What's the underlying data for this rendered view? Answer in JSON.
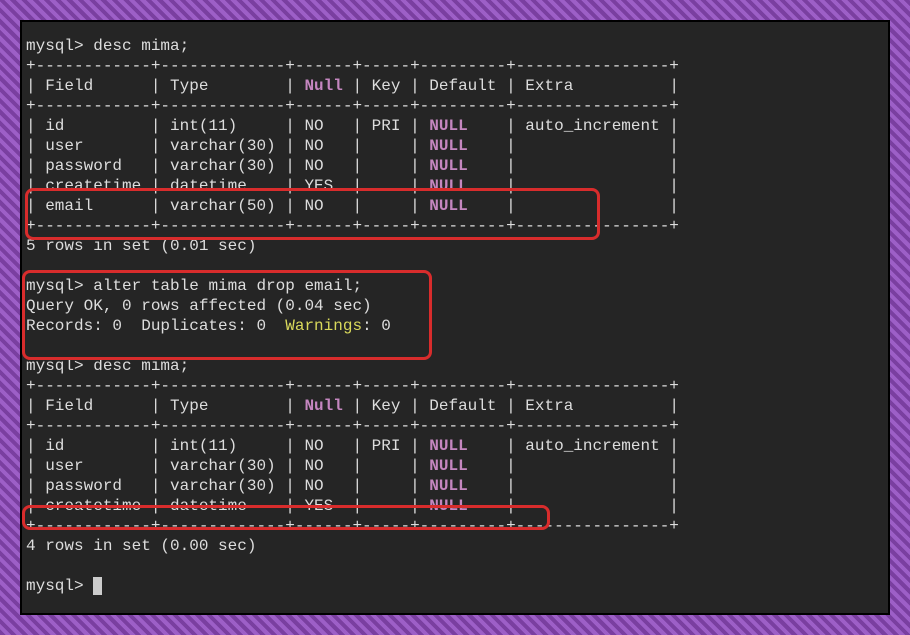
{
  "prompt": "mysql>",
  "cmd1": "desc mima;",
  "table1": {
    "sep_top": "+------------+-------------+------+-----+---------+----------------+",
    "header": "| Field      | Type        | ",
    "header_null": "Null",
    "header2": " | Key | Default | Extra          |",
    "sep_mid": "+------------+-------------+------+-----+---------+----------------+",
    "r1a": "| id         | int(11)     | NO   | PRI | ",
    "r1n": "NULL",
    "r1b": "    | auto_increment |",
    "r2a": "| user       | varchar(30) | NO   |     | ",
    "r2n": "NULL",
    "r2b": "    |                |",
    "r3a": "| password   | varchar(30) | NO   |     | ",
    "r3n": "NULL",
    "r3b": "    |                |",
    "r4a": "| createtime | datetime    | YES  |     | ",
    "r4n": "NULL",
    "r4b": "    |                |",
    "r5a": "| email      | varchar(50) | NO   |     | ",
    "r5n": "NULL",
    "r5b": "    |                |",
    "sep_bot": "+------------+-------------+------+-----+---------+----------------+",
    "footer": "5 rows in set (0.01 sec)"
  },
  "cmd2": "alter table mima drop email;",
  "result2a": "Query OK, 0 rows affected (0.04 sec)",
  "result2b_pre": "Records: 0  Duplicates: 0  ",
  "result2b_warn": "Warnings",
  "result2b_post": ": 0",
  "cmd3": "desc mima;",
  "table2": {
    "sep_top": "+------------+-------------+------+-----+---------+----------------+",
    "header": "| Field      | Type        | ",
    "header_null": "Null",
    "header2": " | Key | Default | Extra          |",
    "sep_mid": "+------------+-------------+------+-----+---------+----------------+",
    "r1a": "| id         | int(11)     | NO   | PRI | ",
    "r1n": "NULL",
    "r1b": "    | auto_increment |",
    "r2a": "| user       | varchar(30) | NO   |     | ",
    "r2n": "NULL",
    "r2b": "    |                |",
    "r3a": "| password   | varchar(30) | NO   |     | ",
    "r3n": "NULL",
    "r3b": "    |                |",
    "r4a": "| createtime | datetime    | YES  |     | ",
    "r4n": "NULL",
    "r4b": "    |                |",
    "sep_bot": "+------------+-------------+------+-----+---------+----------------+",
    "footer": "4 rows in set (0.00 sec)"
  }
}
